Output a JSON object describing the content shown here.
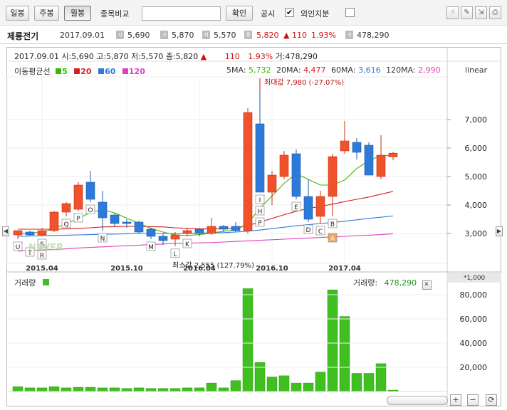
{
  "toolbar": {
    "daily": "일봉",
    "weekly": "주봉",
    "monthly": "월봉",
    "compare_label": "종목비교",
    "compare_placeholder": "",
    "confirm": "확인",
    "disclosure_label": "공시",
    "disclosure_checked": "✔",
    "foreign_label": "외인지분",
    "foreign_checked": ""
  },
  "info": {
    "name": "제룡전기",
    "date": "2017.09.01",
    "open_value": "5,690",
    "high_value": "5,870",
    "low_value": "5,570",
    "close_value": "5,820",
    "change": "▲ 110",
    "change_pct": "1.93%",
    "volume_value": "478,290",
    "badge_open": "시",
    "badge_high": "고",
    "badge_low": "저",
    "badge_close": "종",
    "badge_volume": "거"
  },
  "chart_header": {
    "date": "2017.09.01",
    "ohlc": "시:5,690 고:5,870 저:5,570 종:5,820",
    "arrow": "▲",
    "change": "110",
    "change_pct": "1.93%",
    "volume": "거:478,290"
  },
  "legend": {
    "title": "이동평균선",
    "ma5": "5",
    "ma20": "20",
    "ma60": "60",
    "ma120": "120",
    "ma5_label": "5MA:",
    "ma5_value": "5,732",
    "ma20_label": "20MA:",
    "ma20_value": "4,477",
    "ma60_label": "60MA:",
    "ma60_value": "3,616",
    "ma120_label": "120MA:",
    "ma120_value": "2,990",
    "scale": "linear"
  },
  "colors": {
    "up": "#f0522c",
    "down": "#2d7ad8",
    "ma5": "#3cb800",
    "ma20": "#d62020",
    "ma60": "#2e7bd6",
    "ma120": "#e040c0",
    "volume": "#40c020"
  },
  "annotations": {
    "max": "최대값 7,980 (-27.07%)",
    "min": "최소값 2,555 (127.79%)",
    "watermark": "NAVER"
  },
  "volume": {
    "label": "거래량",
    "right_label": "거래량:",
    "right_value": "478,290",
    "unit": "*1,000"
  },
  "chart_data": {
    "type": "candlestick",
    "x_labels": [
      "2015.04",
      "2015.10",
      "2016.04",
      "2016.10",
      "2017.04"
    ],
    "y_ticks": [
      "3,000",
      "4,000",
      "5,000",
      "6,000",
      "7,000"
    ],
    "vol_ticks": [
      "20,000",
      "40,000",
      "60,000",
      "80,000"
    ],
    "candles": [
      {
        "o": 2950,
        "h": 3100,
        "l": 2800,
        "c": 3100,
        "v": 4000
      },
      {
        "o": 3050,
        "h": 3100,
        "l": 2900,
        "c": 2950,
        "v": 3000
      },
      {
        "o": 2950,
        "h": 3200,
        "l": 2900,
        "c": 3100,
        "v": 3000
      },
      {
        "o": 3100,
        "h": 3800,
        "l": 3050,
        "c": 3750,
        "v": 4000
      },
      {
        "o": 3750,
        "h": 4100,
        "l": 3600,
        "c": 4050,
        "v": 3000
      },
      {
        "o": 3850,
        "h": 4800,
        "l": 3800,
        "c": 4700,
        "v": 3500
      },
      {
        "o": 4800,
        "h": 5200,
        "l": 4100,
        "c": 4200,
        "v": 3500
      },
      {
        "o": 4100,
        "h": 4500,
        "l": 3100,
        "c": 3550,
        "v": 3000
      },
      {
        "o": 3650,
        "h": 3700,
        "l": 3250,
        "c": 3350,
        "v": 3000
      },
      {
        "o": 3400,
        "h": 3500,
        "l": 3200,
        "c": 3350,
        "v": 2500
      },
      {
        "o": 3400,
        "h": 3450,
        "l": 3000,
        "c": 3050,
        "v": 3000
      },
      {
        "o": 3150,
        "h": 3200,
        "l": 2800,
        "c": 2900,
        "v": 2500
      },
      {
        "o": 2900,
        "h": 3000,
        "l": 2600,
        "c": 2750,
        "v": 2500
      },
      {
        "o": 2800,
        "h": 3050,
        "l": 2555,
        "c": 2950,
        "v": 2500
      },
      {
        "o": 3000,
        "h": 3200,
        "l": 2900,
        "c": 3100,
        "v": 3000
      },
      {
        "o": 3150,
        "h": 3200,
        "l": 2900,
        "c": 3000,
        "v": 3000
      },
      {
        "o": 3000,
        "h": 3550,
        "l": 2950,
        "c": 3250,
        "v": 7000
      },
      {
        "o": 3250,
        "h": 3300,
        "l": 3050,
        "c": 3150,
        "v": 3000
      },
      {
        "o": 3250,
        "h": 3400,
        "l": 3050,
        "c": 3100,
        "v": 9000
      },
      {
        "o": 3100,
        "h": 7400,
        "l": 3000,
        "c": 7250,
        "v": 85000
      },
      {
        "o": 6850,
        "h": 7980,
        "l": 4450,
        "c": 4450,
        "v": 24000
      },
      {
        "o": 4450,
        "h": 5200,
        "l": 4000,
        "c": 5050,
        "v": 12000
      },
      {
        "o": 5000,
        "h": 5900,
        "l": 4900,
        "c": 5750,
        "v": 13000
      },
      {
        "o": 5800,
        "h": 5950,
        "l": 4200,
        "c": 4300,
        "v": 7000
      },
      {
        "o": 4300,
        "h": 4900,
        "l": 3400,
        "c": 3500,
        "v": 7000
      },
      {
        "o": 3600,
        "h": 4500,
        "l": 3350,
        "c": 4300,
        "v": 16000
      },
      {
        "o": 4300,
        "h": 5800,
        "l": 3600,
        "c": 5700,
        "v": 84000
      },
      {
        "o": 5900,
        "h": 6950,
        "l": 5800,
        "c": 6250,
        "v": 62000
      },
      {
        "o": 6200,
        "h": 6350,
        "l": 5600,
        "c": 5850,
        "v": 15000
      },
      {
        "o": 6100,
        "h": 6200,
        "l": 5100,
        "c": 5050,
        "v": 15000
      },
      {
        "o": 5000,
        "h": 6450,
        "l": 4900,
        "c": 5750,
        "v": 23000
      },
      {
        "o": 5690,
        "h": 5870,
        "l": 5570,
        "c": 5820,
        "v": 478
      }
    ],
    "ma5": [
      2990,
      3020,
      3040,
      3180,
      3340,
      3520,
      3740,
      3840,
      3720,
      3540,
      3360,
      3180,
      3050,
      2950,
      2930,
      2960,
      3010,
      3080,
      3120,
      3350,
      3880,
      4320,
      4760,
      5100,
      4900,
      4700,
      4700,
      4880,
      5280,
      5560,
      5740,
      5732
    ],
    "ma20": [
      3150,
      3150,
      3150,
      3150,
      3160,
      3180,
      3200,
      3230,
      3240,
      3250,
      3250,
      3240,
      3230,
      3200,
      3180,
      3160,
      3160,
      3170,
      3200,
      3280,
      3400,
      3530,
      3660,
      3780,
      3880,
      3950,
      4030,
      4120,
      4200,
      4280,
      4380,
      4477
    ],
    "ma60": [
      2900,
      2910,
      2920,
      2930,
      2940,
      2950,
      2960,
      2970,
      2980,
      2990,
      3000,
      3000,
      3000,
      3000,
      3000,
      3010,
      3020,
      3030,
      3050,
      3080,
      3120,
      3170,
      3220,
      3270,
      3310,
      3350,
      3390,
      3430,
      3480,
      3530,
      3570,
      3616
    ],
    "ma120": [
      2380,
      2400,
      2420,
      2440,
      2460,
      2490,
      2510,
      2530,
      2550,
      2570,
      2590,
      2610,
      2630,
      2650,
      2660,
      2670,
      2680,
      2700,
      2720,
      2740,
      2760,
      2780,
      2800,
      2820,
      2840,
      2860,
      2880,
      2900,
      2920,
      2940,
      2960,
      2990
    ],
    "markers": [
      {
        "i": 0,
        "label": "U",
        "pos": "below",
        "offset": 0
      },
      {
        "i": 1,
        "label": "T",
        "pos": "below",
        "offset": 12
      },
      {
        "i": 2,
        "label": "S",
        "pos": "below",
        "offset": 0
      },
      {
        "i": 2,
        "label": "R",
        "pos": "below",
        "offset": 16
      },
      {
        "i": 4,
        "label": "Q",
        "pos": "below",
        "offset": 0
      },
      {
        "i": 5,
        "label": "P",
        "pos": "below",
        "offset": 0
      },
      {
        "i": 6,
        "label": "O",
        "pos": "below",
        "offset": 0
      },
      {
        "i": 7,
        "label": "N",
        "pos": "below",
        "offset": 0
      },
      {
        "i": 11,
        "label": "M",
        "pos": "below",
        "offset": 0
      },
      {
        "i": 13,
        "label": "L",
        "pos": "below",
        "offset": 0
      },
      {
        "i": 14,
        "label": "K",
        "pos": "below",
        "offset": 0
      },
      {
        "i": 20,
        "label": "I",
        "pos": "below",
        "offset": 0
      },
      {
        "i": 20,
        "label": "H",
        "pos": "below",
        "offset": 16
      },
      {
        "i": 20,
        "label": "P",
        "pos": "below",
        "offset": 32
      },
      {
        "i": 23,
        "label": "E",
        "pos": "below",
        "offset": 0
      },
      {
        "i": 24,
        "label": "D",
        "pos": "below",
        "offset": 0
      },
      {
        "i": 25,
        "label": "C",
        "pos": "below",
        "offset": 0
      },
      {
        "i": 26,
        "label": "B",
        "pos": "below",
        "offset": 0
      },
      {
        "i": 26,
        "label": "A",
        "pos": "below",
        "offset": 20,
        "color": "#f4a460"
      }
    ]
  }
}
